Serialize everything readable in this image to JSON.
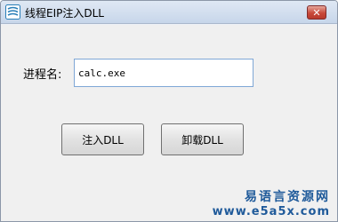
{
  "window": {
    "title": "线程EIP注入DLL",
    "close_label": "✕"
  },
  "form": {
    "process_label": "进程名:",
    "process_value": "calc.exe"
  },
  "buttons": {
    "inject_label": "注入DLL",
    "unload_label": "卸载DLL"
  },
  "watermark": {
    "chinese": "易语言资源网",
    "url": "www.e5a5x.com"
  },
  "colors": {
    "accent": "#1f5a9a",
    "close_red": "#c8493a"
  }
}
